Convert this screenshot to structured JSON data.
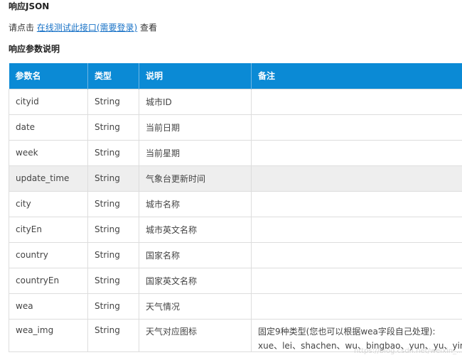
{
  "headings": {
    "response_json": "响应JSON",
    "response_params": "响应参数说明"
  },
  "online_test": {
    "prefix": "请点击 ",
    "link": "在线测试此接口(需要登录)",
    "suffix": " 查看"
  },
  "table": {
    "headers": [
      "参数名",
      "类型",
      "说明",
      "备注"
    ],
    "rows": [
      {
        "name": "cityid",
        "type": "String",
        "desc": "城市ID",
        "note": ""
      },
      {
        "name": "date",
        "type": "String",
        "desc": "当前日期",
        "note": ""
      },
      {
        "name": "week",
        "type": "String",
        "desc": "当前星期",
        "note": ""
      },
      {
        "name": "update_time",
        "type": "String",
        "desc": "气象台更新时间",
        "note": ""
      },
      {
        "name": "city",
        "type": "String",
        "desc": "城市名称",
        "note": ""
      },
      {
        "name": "cityEn",
        "type": "String",
        "desc": "城市英文名称",
        "note": ""
      },
      {
        "name": "country",
        "type": "String",
        "desc": "国家名称",
        "note": ""
      },
      {
        "name": "countryEn",
        "type": "String",
        "desc": "国家英文名称",
        "note": ""
      },
      {
        "name": "wea",
        "type": "String",
        "desc": "天气情况",
        "note": ""
      },
      {
        "name": "wea_img",
        "type": "String",
        "desc": "天气对应图标",
        "note": "固定9种类型(您也可以根据wea字段自己处理):",
        "note2": "xue、lei、shachen、wu、bingbao、yun、yu、yin、qin"
      }
    ]
  },
  "watermark": "https://blog.csdn.net/weixin_..."
}
